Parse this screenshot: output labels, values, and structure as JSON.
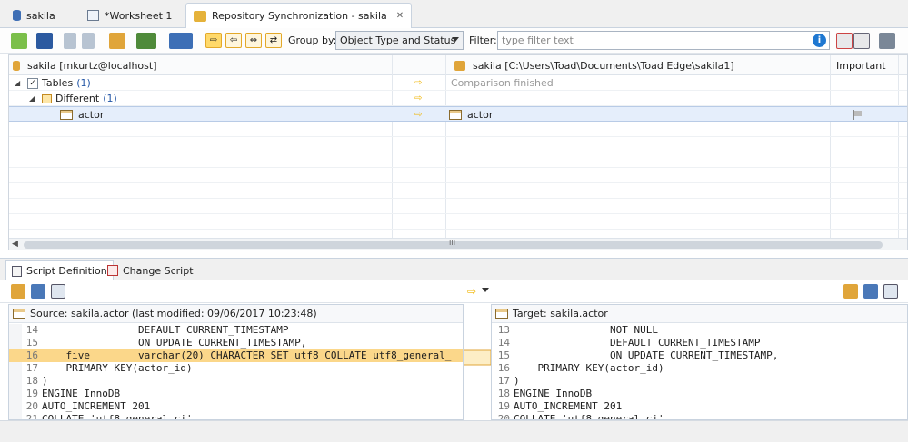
{
  "tabs": [
    {
      "label": "sakila",
      "icon": "database-icon"
    },
    {
      "label": "*Worksheet 1",
      "icon": "sql-worksheet-icon"
    },
    {
      "label": "Repository Synchronization - sakila",
      "icon": "sync-icon",
      "close": "✕"
    }
  ],
  "toolbar": {
    "group_by_label": "Group by:",
    "group_by_value": "Object Type and Status",
    "filter_label": "Filter:",
    "filter_placeholder": "type filter text"
  },
  "grid": {
    "left_header": "sakila [mkurtz@localhost]",
    "right_header": "sakila [C:\\Users\\Toad\\Documents\\Toad Edge\\sakila1]",
    "important_header": "Important",
    "rows": [
      {
        "left": "Tables",
        "left_count": "(1)",
        "right": "Comparison finished"
      },
      {
        "left": "Different",
        "left_count": "(1)",
        "right": ""
      },
      {
        "left": "actor",
        "left_count": "",
        "right": "actor"
      }
    ],
    "hscroll_grip": "III"
  },
  "bottom_tabs": {
    "script_definition": "Script Definition",
    "change_script": "Change Script"
  },
  "source": {
    "title": "Source: sakila.actor (last modified: 09/06/2017 10:23:48)",
    "lines": [
      {
        "n": "14",
        "text": "                DEFAULT CURRENT_TIMESTAMP"
      },
      {
        "n": "15",
        "text": "                ON UPDATE CURRENT_TIMESTAMP,"
      },
      {
        "n": "16",
        "text": "    five        varchar(20) CHARACTER SET utf8 COLLATE utf8_general_"
      },
      {
        "n": "17",
        "text": "    PRIMARY KEY(actor_id)"
      },
      {
        "n": "18",
        "text": ")"
      },
      {
        "n": "19",
        "text": "ENGINE InnoDB"
      },
      {
        "n": "20",
        "text": "AUTO_INCREMENT 201"
      },
      {
        "n": "21",
        "text": "COLLATE 'utf8_general_ci'"
      }
    ]
  },
  "target": {
    "title": "Target: sakila.actor",
    "lines": [
      {
        "n": "13",
        "text": "                NOT NULL"
      },
      {
        "n": "14",
        "text": "                DEFAULT CURRENT_TIMESTAMP"
      },
      {
        "n": "15",
        "text": "                ON UPDATE CURRENT_TIMESTAMP,"
      },
      {
        "n": "16",
        "text": "    PRIMARY KEY(actor_id)"
      },
      {
        "n": "17",
        "text": ")"
      },
      {
        "n": "18",
        "text": "ENGINE InnoDB"
      },
      {
        "n": "19",
        "text": "AUTO_INCREMENT 201"
      },
      {
        "n": "20",
        "text": "COLLATE 'utf8_general_ci'"
      }
    ]
  },
  "colors": {
    "accent_orange": "#f0b400",
    "selection": "#e5eefb",
    "highlight": "#fbd78a",
    "link_blue": "#2457a6"
  }
}
